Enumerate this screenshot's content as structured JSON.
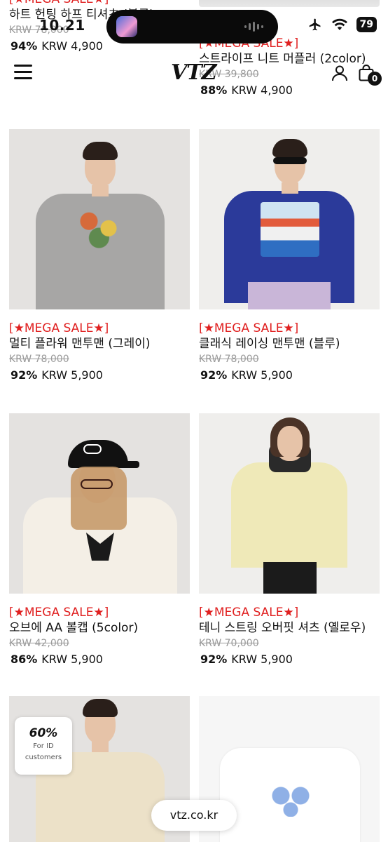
{
  "status_bar": {
    "time": "10.21",
    "battery": "79"
  },
  "header": {
    "logo": "VTZ",
    "cart_count": "0"
  },
  "peek_products": [
    {
      "sale_tag": "[★MEGA SALE★]",
      "name": "하트 헌팅 하프 티셔츠 (블루)",
      "original_price": "KRW 78,000",
      "discount": "94%",
      "price": "KRW 4,900"
    },
    {
      "sale_tag": "[★MEGA SALE★]",
      "name": "스트라이프 니트 머플러 (2color)",
      "original_price": "KRW 39,800",
      "discount": "88%",
      "price": "KRW 4,900"
    }
  ],
  "products": [
    {
      "sale_tag": "[★MEGA SALE★]",
      "name": "멀티 플라워 맨투맨 (그레이)",
      "original_price": "KRW 78,000",
      "discount": "92%",
      "price": "KRW 5,900"
    },
    {
      "sale_tag": "[★MEGA SALE★]",
      "name": "클래식 레이싱 맨투맨 (블루)",
      "original_price": "KRW 78,000",
      "discount": "92%",
      "price": "KRW 5,900"
    },
    {
      "sale_tag": "[★MEGA SALE★]",
      "name": "오브에 AA 볼캡 (5color)",
      "original_price": "KRW 42,000",
      "discount": "86%",
      "price": "KRW 5,900"
    },
    {
      "sale_tag": "[★MEGA SALE★]",
      "name": "테니 스트링 오버핏 셔츠 (옐로우)",
      "original_price": "KRW 70,000",
      "discount": "92%",
      "price": "KRW 5,900"
    }
  ],
  "coupon": {
    "percent": "60%",
    "line1": "For ID",
    "line2": "customers"
  },
  "url_bar": {
    "domain": "vtz.co.kr"
  },
  "colors": {
    "sale_red": "#e02020",
    "text": "#111111",
    "muted": "#9a9a9a"
  }
}
